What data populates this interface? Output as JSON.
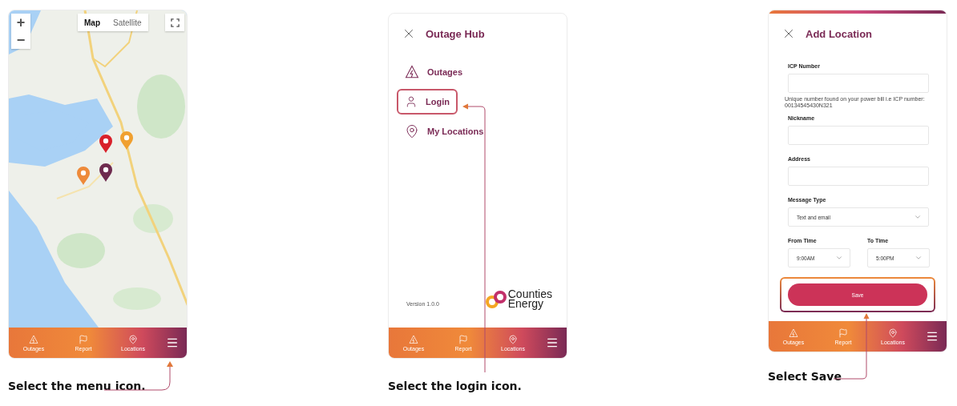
{
  "panels": [
    {
      "kind": "map",
      "zoom_in": "+",
      "zoom_out": "−",
      "map_types": [
        {
          "label": "Map",
          "selected": true
        },
        {
          "label": "Satellite",
          "selected": false
        }
      ],
      "nav": [
        {
          "kind": "outage",
          "label": "Outages"
        },
        {
          "kind": "flag",
          "label": "Report"
        },
        {
          "kind": "pin",
          "label": "Locations"
        },
        {
          "kind": "menu"
        }
      ],
      "caption": "Select the menu icon."
    },
    {
      "kind": "menu",
      "title": "Outage Hub",
      "items": [
        {
          "kind": "outage",
          "label": "Outages",
          "highlighted": false
        },
        {
          "kind": "user",
          "label": "Login",
          "highlighted": true
        },
        {
          "kind": "pin",
          "label": "My Locations",
          "highlighted": false
        }
      ],
      "version": "Version 1.0.0",
      "logo": {
        "line_1": "Counties",
        "line_2": "Energy"
      },
      "nav": [
        {
          "kind": "outage",
          "label": "Outages"
        },
        {
          "kind": "flag",
          "label": "Report"
        },
        {
          "kind": "pin",
          "label": "Locations"
        },
        {
          "kind": "menu"
        }
      ],
      "caption": "Select the login icon."
    },
    {
      "kind": "form",
      "title": "Add Location",
      "fields": [
        {
          "kind": "text",
          "label": "ICP Number",
          "hint": "Unique number found on your power bill i.e ICP number: 00134545430N321"
        },
        {
          "kind": "text",
          "label": "Nickname"
        },
        {
          "kind": "text",
          "label": "Address"
        },
        {
          "kind": "select",
          "label": "Message Type",
          "value": "Text and email"
        }
      ],
      "time_fields": [
        {
          "label": "From Time",
          "value": "9:00AM"
        },
        {
          "label": "To Time",
          "value": "5:00PM"
        }
      ],
      "save": {
        "label": "Save",
        "highlighted": true
      },
      "nav": [
        {
          "kind": "outage",
          "label": "Outages"
        },
        {
          "kind": "flag",
          "label": "Report"
        },
        {
          "kind": "pin",
          "label": "Locations"
        },
        {
          "kind": "menu"
        }
      ],
      "caption": "Select Save"
    }
  ]
}
